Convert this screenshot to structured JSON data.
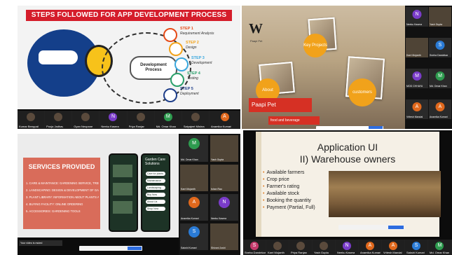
{
  "panel1": {
    "title": "STEPS FOLLOWED FOR APP DEVELOPMENT PROCESS",
    "center_label_1": "Development",
    "center_label_2": "Process",
    "steps": [
      {
        "label": "STEP 1",
        "desc": "Requirement Analysis",
        "color": "#e64b18"
      },
      {
        "label": "STEP 2",
        "desc": "Design",
        "color": "#f2a31b"
      },
      {
        "label": "STEP 3",
        "desc": "Development",
        "color": "#3aa8de"
      },
      {
        "label": "STEP 4",
        "desc": "Testing",
        "color": "#2aa06b"
      },
      {
        "label": "STEP 5",
        "desc": "Deployment",
        "color": "#1f3f8a"
      }
    ],
    "participants": [
      {
        "initial": "",
        "name": "Kumar Beeppali",
        "color": "#5a4a3c"
      },
      {
        "initial": "",
        "name": "Pooja Jadhav",
        "color": "#5a4a3c"
      },
      {
        "initial": "",
        "name": "Gyan Neupane",
        "color": "#5a4a3c"
      },
      {
        "initial": "N",
        "name": "Neeku Kasera",
        "color": "#7a3cc9"
      },
      {
        "initial": "",
        "name": "Priya Ranjan",
        "color": "#5a4a3c"
      },
      {
        "initial": "M",
        "name": "Md. Omar Khan",
        "color": "#2e9b4f"
      },
      {
        "initial": "",
        "name": "Satyajeet Mishra",
        "color": "#5a4a3c"
      },
      {
        "initial": "A",
        "name": "Anamika Kumari",
        "color": "#e0681c"
      }
    ]
  },
  "panel2": {
    "logo": "W",
    "tagline": "Paapi Pet",
    "badges": [
      "Key Projects",
      "About",
      "customers"
    ],
    "brand": "Paapi Pet",
    "sub": "food and beverage",
    "participants": [
      {
        "initial": "N",
        "name": "Neeku Kasera",
        "color": "#7a3cc9"
      },
      {
        "initial": "",
        "name": "Yash Gupta",
        "color": "#5a4a3c"
      },
      {
        "initial": "",
        "name": "Karri Mojanth",
        "color": "#5a4a3c"
      },
      {
        "initial": "S",
        "name": "Sneha Dandekar",
        "color": "#2a7bd6"
      },
      {
        "initial": "M",
        "name": "MOD CHHAYA",
        "color": "#7a3cc9"
      },
      {
        "initial": "M",
        "name": "Md. Omar Khan",
        "color": "#2e9b4f"
      },
      {
        "initial": "A",
        "name": "Vritesh Mandal",
        "color": "#e0681c"
      },
      {
        "initial": "A",
        "name": "Anamika Kumari",
        "color": "#e0681c"
      }
    ]
  },
  "panel3": {
    "heading": "SERVICES PROVIDED",
    "services": [
      "1. CARE & MAINTANCE: GARDENING SERVICE, TREE PRUNING, REGULAR MAINTENANCE",
      "2. LANDSCAPING: DESIGN & DEVELOPMENT OF GARDENS AND LAWNS",
      "3. PLANT LIBRARY: INFORMATION ABOUT PLANTS AND CARE",
      "4. BUYING FACILITY: ONLINE ORDERING",
      "5. ACCESSORIES: GARDENING TOOLS"
    ],
    "app_title": "Garden Care Solutions",
    "menu": [
      "Care for plants",
      "Maintenance",
      "Landscaping",
      "Buy Now",
      "About Us",
      "Shop Now"
    ],
    "notice": "Your video is muted",
    "participants": [
      {
        "initial": "M",
        "name": "Md. Omar Khan",
        "color": "#2e9b4f"
      },
      {
        "initial": "",
        "name": "Yash Gupta",
        "color": "#5a4a3c"
      },
      {
        "initial": "",
        "name": "Karri Mojanth",
        "color": "#5a4a3c"
      },
      {
        "initial": "",
        "name": "Ishan Rao",
        "color": "#5a4a3c"
      },
      {
        "initial": "A",
        "name": "Anamika Kumari",
        "color": "#e0681c"
      },
      {
        "initial": "N",
        "name": "Neeku Kasera",
        "color": "#7a3cc9"
      },
      {
        "initial": "S",
        "name": "Sakshi Kumari",
        "color": "#2a7bd6"
      },
      {
        "initial": "",
        "name": "Shivani Joshi",
        "color": "#5a4a3c"
      }
    ]
  },
  "panel4": {
    "title_line1": "Application UI",
    "title_line2": "II) Warehouse owners",
    "bullets": [
      "Available farmers",
      "Crop price",
      "Farmer's rating",
      "Available stock",
      "Booking the quantity",
      "Payment (Partial, Full)"
    ],
    "participants": [
      {
        "initial": "S",
        "name": "Sneha Dandekar",
        "color": "#c43a6b"
      },
      {
        "initial": "",
        "name": "Karri Mojanth",
        "color": "#5a4a3c"
      },
      {
        "initial": "",
        "name": "Priya Ranjan",
        "color": "#5a4a3c"
      },
      {
        "initial": "",
        "name": "Yash Gupta",
        "color": "#5a4a3c"
      },
      {
        "initial": "N",
        "name": "Neeku Kasera",
        "color": "#7a3cc9"
      },
      {
        "initial": "A",
        "name": "Anamika Kumari",
        "color": "#e0681c"
      },
      {
        "initial": "A",
        "name": "Vritesh Mandal",
        "color": "#e0681c"
      },
      {
        "initial": "S",
        "name": "Sakshi Kumari",
        "color": "#2a7bd6"
      },
      {
        "initial": "M",
        "name": "Md. Omar Khan",
        "color": "#2e9b4f"
      }
    ]
  }
}
